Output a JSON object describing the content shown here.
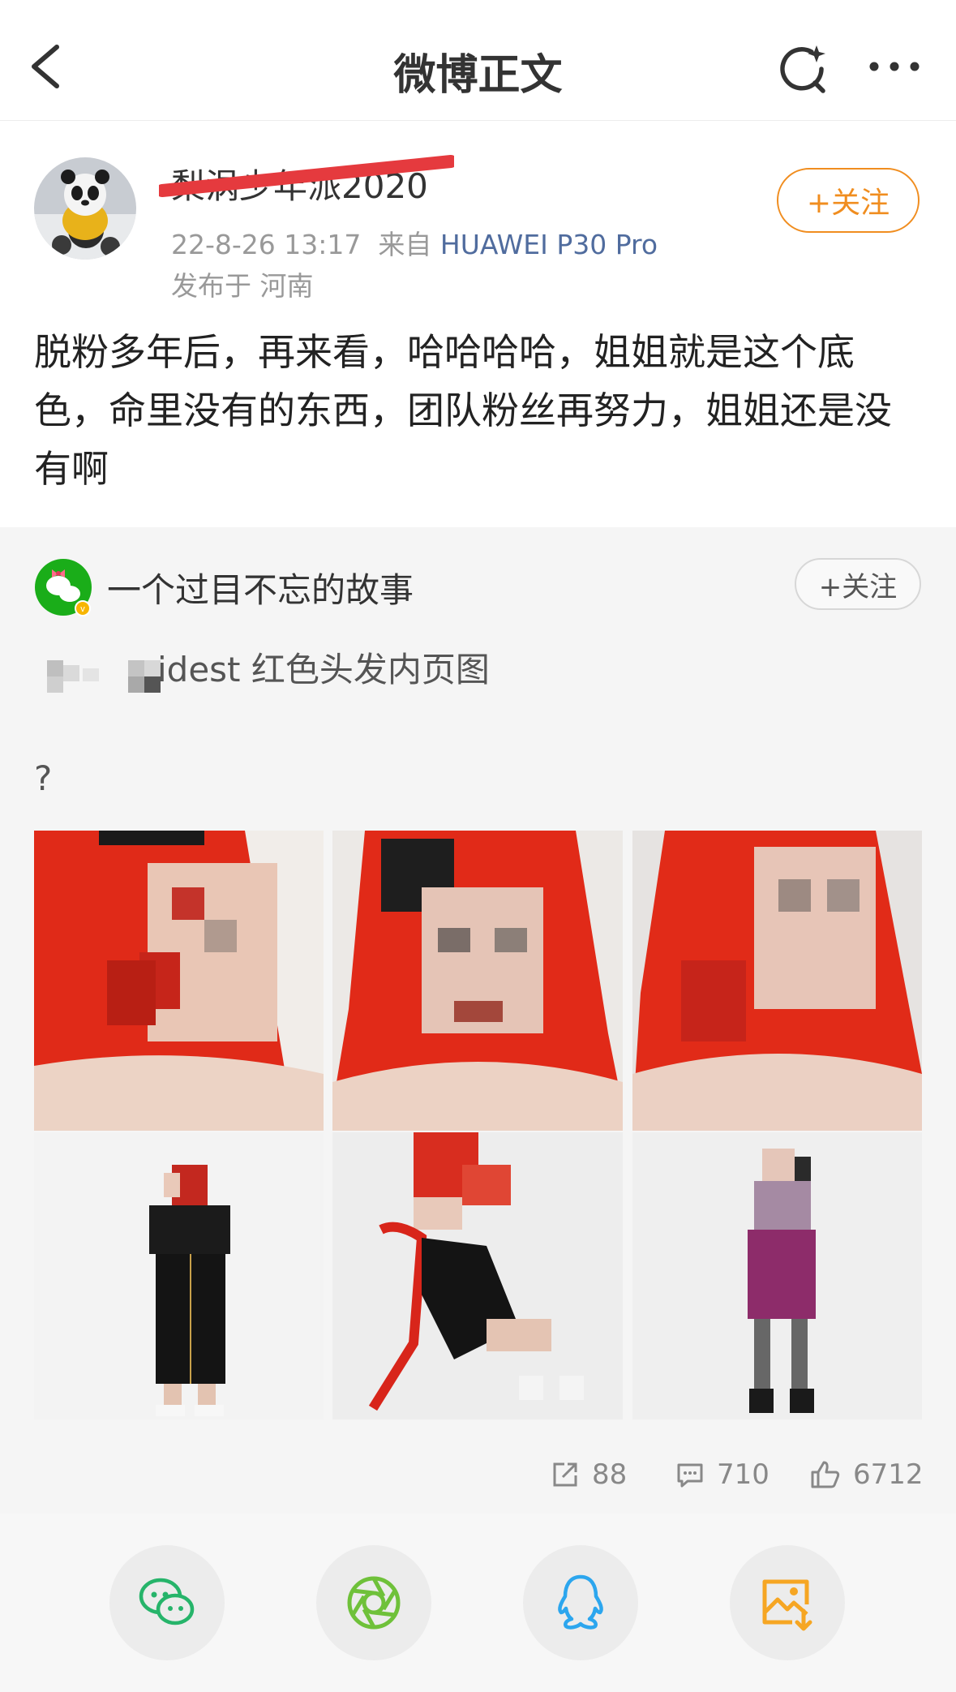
{
  "nav": {
    "title": "微博正文"
  },
  "author": {
    "name": "梨涡少年派2020",
    "time": "22-8-26 13:17",
    "from_label": "来自",
    "source": "HUAWEI P30 Pro",
    "location": "发布于 河南",
    "follow_label": "+关注"
  },
  "post": {
    "text": "脱粉多年后，再来看，哈哈哈哈，姐姐就是这个底色，命里没有的东西，团队粉丝再努力，姐姐还是没有啊"
  },
  "repost": {
    "name": "一个过目不忘的故事",
    "follow_label": "+关注",
    "text": "idest 红色头发内页图",
    "question": "?",
    "stats": {
      "shares": "88",
      "comments": "710",
      "likes": "6712"
    }
  },
  "share": [
    "wechat-icon",
    "moments-icon",
    "qq-icon",
    "save-image-icon"
  ],
  "colors": {
    "accent": "#f08d1f",
    "link": "#506c9e",
    "wechat": "#1aad19"
  }
}
